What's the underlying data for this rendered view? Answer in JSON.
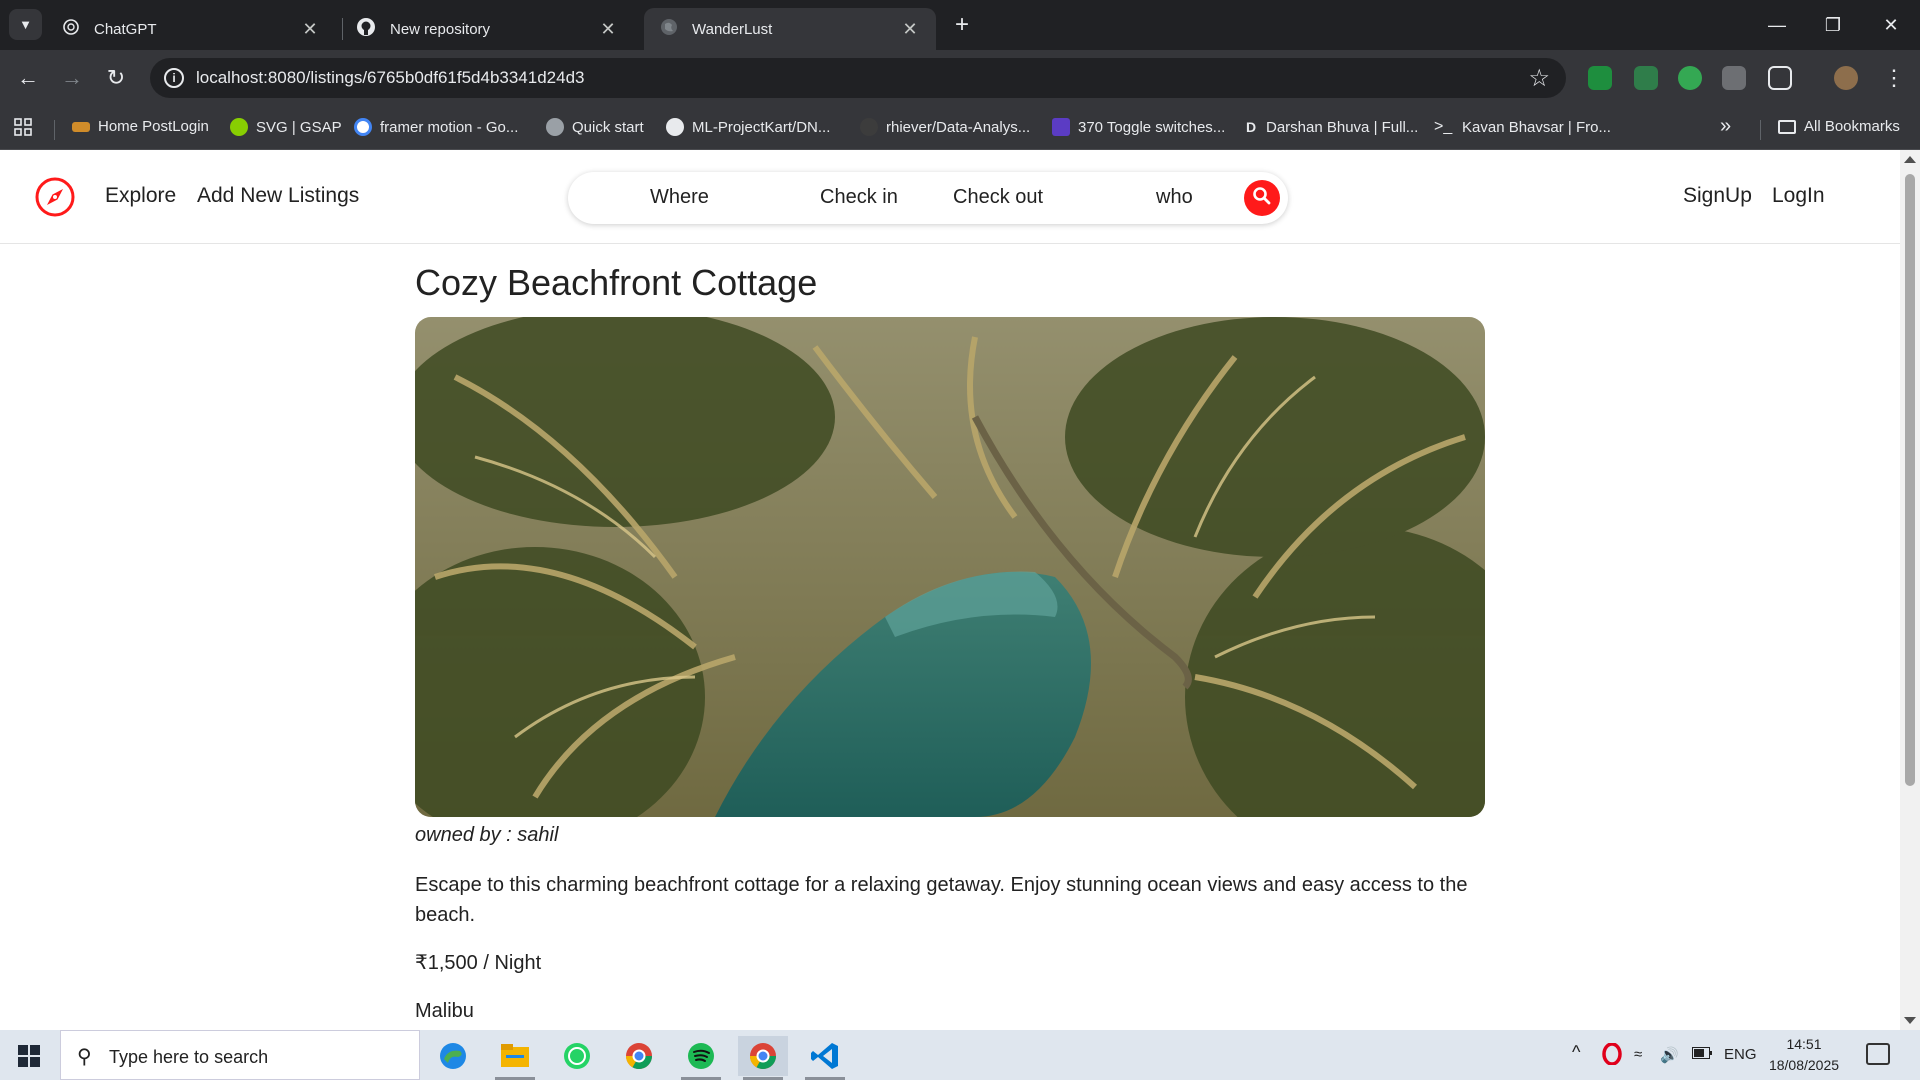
{
  "browser": {
    "tabs": [
      {
        "title": "ChatGPT",
        "icon": "chatgpt-icon"
      },
      {
        "title": "New repository",
        "icon": "github-icon"
      },
      {
        "title": "WanderLust",
        "icon": "globe-icon",
        "active": true
      }
    ],
    "url": "localhost:8080/listings/6765b0df61f5d4b3341d24d3",
    "bookmarks": [
      "Home PostLogin",
      "SVG | GSAP",
      "framer motion - Go...",
      "Quick start",
      "ML-ProjectKart/DN...",
      "rhiever/Data-Analys...",
      "370 Toggle switches...",
      "Darshan Bhuva | Full...",
      "Kavan Bhavsar | Fro..."
    ],
    "all_bookmarks": "All Bookmarks"
  },
  "navbar": {
    "explore": "Explore",
    "add_listing": "Add New Listings",
    "search": {
      "where": "Where",
      "checkin": "Check in",
      "checkout": "Check out",
      "who": "who"
    },
    "signup": "SignUp",
    "login": "LogIn",
    "brand_color": "#ff1a1a"
  },
  "listing": {
    "title": "Cozy Beachfront Cottage",
    "owner": "owned by : sahil",
    "description": "Escape to this charming beachfront cottage for a relaxing getaway. Enjoy stunning ocean views and easy access to the beach.",
    "price": "₹1,500 / Night",
    "location": "Malibu"
  },
  "taskbar": {
    "search_placeholder": "Type here to search",
    "lang": "ENG",
    "time": "14:51",
    "date": "18/08/2025"
  }
}
